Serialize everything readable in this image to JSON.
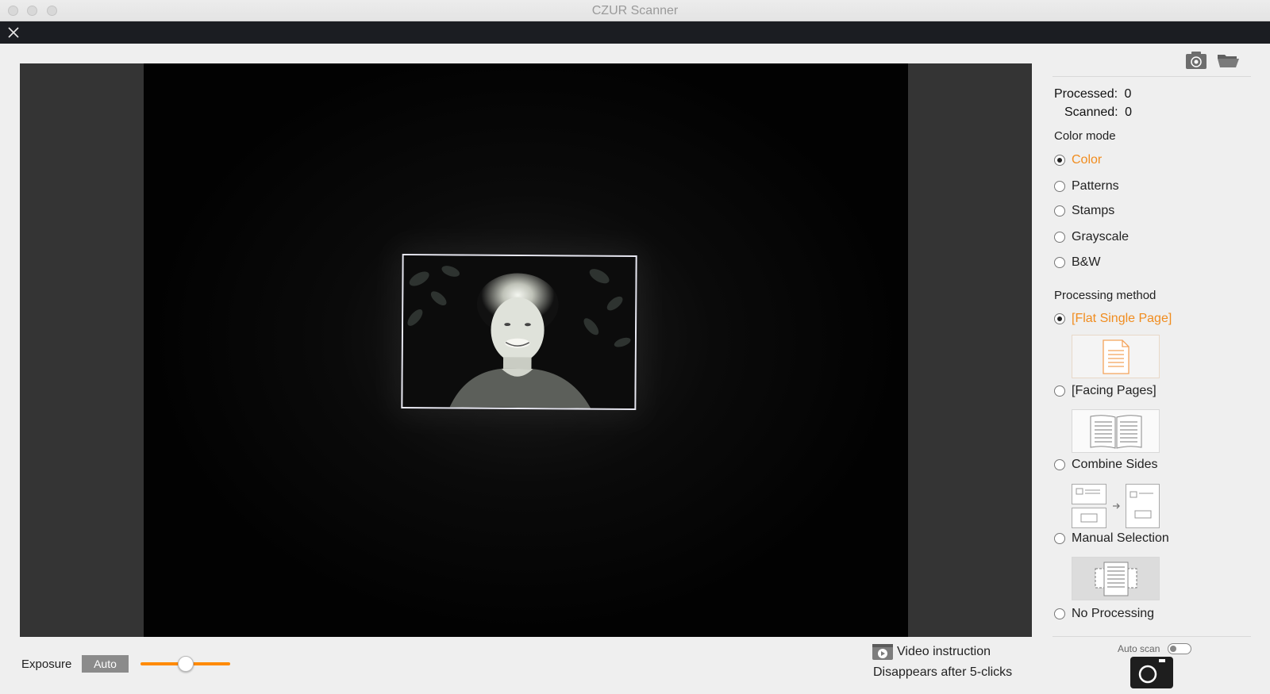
{
  "window": {
    "title": "CZUR Scanner"
  },
  "stats": {
    "processed_label": "Processed:",
    "processed_value": "0",
    "scanned_label": "Scanned:",
    "scanned_value": "0"
  },
  "color_mode": {
    "title": "Color mode",
    "options": [
      {
        "label": "Color",
        "selected": true
      },
      {
        "label": "Patterns",
        "selected": false
      },
      {
        "label": "Stamps",
        "selected": false
      },
      {
        "label": "Grayscale",
        "selected": false
      },
      {
        "label": "B&W",
        "selected": false
      }
    ]
  },
  "processing_method": {
    "title": "Processing method",
    "options": [
      {
        "label": "[Flat Single Page]",
        "selected": true
      },
      {
        "label": "[Facing Pages]",
        "selected": false
      },
      {
        "label": "Combine Sides",
        "selected": false
      },
      {
        "label": "Manual Selection",
        "selected": false
      },
      {
        "label": "No Processing",
        "selected": false
      }
    ]
  },
  "exposure": {
    "label": "Exposure",
    "mode_button": "Auto",
    "level": 0.5
  },
  "video": {
    "label": "Video instruction",
    "hint": "Disappears after 5-clicks"
  },
  "autoscan": {
    "label": "Auto scan",
    "enabled": false
  },
  "toolbar": {
    "settings_icon": "camera-settings-icon",
    "folder_icon": "open-folder-icon"
  },
  "colors": {
    "accent": "#f08c1e",
    "slider": "#ff8a00",
    "dark_bar": "#1b1d22"
  }
}
